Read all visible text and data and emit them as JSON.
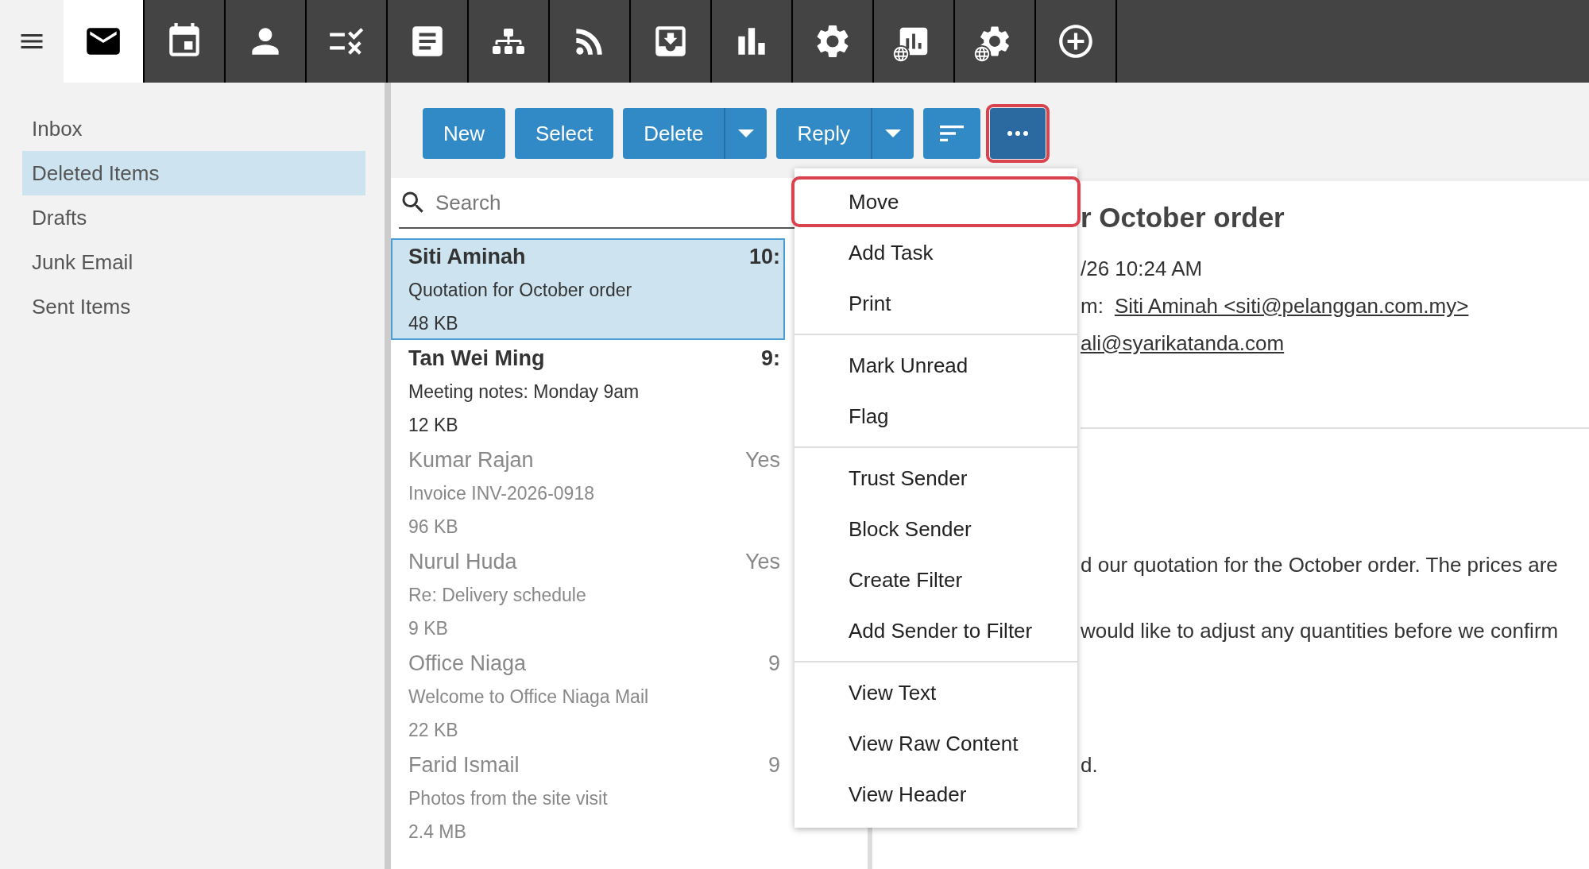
{
  "app_tabs": [
    {
      "kind": "mail",
      "selected": true
    },
    {
      "kind": "calendar",
      "selected": false
    },
    {
      "kind": "contacts",
      "selected": false
    },
    {
      "kind": "tasks",
      "selected": false
    },
    {
      "kind": "notes",
      "selected": false
    },
    {
      "kind": "tree",
      "selected": false
    },
    {
      "kind": "rss",
      "selected": false
    },
    {
      "kind": "inbox",
      "selected": false
    },
    {
      "kind": "stats",
      "selected": false
    },
    {
      "kind": "settings",
      "selected": false
    },
    {
      "kind": "webstats",
      "selected": false
    },
    {
      "kind": "websettings",
      "selected": false
    },
    {
      "kind": "add",
      "selected": false
    }
  ],
  "folders": [
    {
      "label": "Inbox",
      "selected": false
    },
    {
      "label": "Deleted Items",
      "selected": true
    },
    {
      "label": "Drafts",
      "selected": false
    },
    {
      "label": "Junk Email",
      "selected": false
    },
    {
      "label": "Sent Items",
      "selected": false
    }
  ],
  "toolbar": [
    {
      "kind": "button",
      "label": "New",
      "focused": false
    },
    {
      "kind": "button",
      "label": "Select",
      "focused": false
    },
    {
      "kind": "split",
      "label": "Delete",
      "focused": false
    },
    {
      "kind": "split",
      "label": "Reply",
      "focused": false
    },
    {
      "kind": "sort",
      "focused": false
    },
    {
      "kind": "more",
      "focused": true
    }
  ],
  "search": {
    "placeholder": "Search"
  },
  "messages": [
    {
      "sender": "Siti Aminah",
      "time": "10:",
      "subject": "Quotation for October order",
      "size": "48 KB",
      "unread": true,
      "selected": true
    },
    {
      "sender": "Tan Wei Ming",
      "time": "9:",
      "subject": "Meeting notes: Monday 9am",
      "size": "12 KB",
      "unread": true,
      "selected": false
    },
    {
      "sender": "Kumar Rajan",
      "time": "Yes",
      "subject": "Invoice INV-2026-0918",
      "size": "96 KB",
      "unread": false,
      "selected": false
    },
    {
      "sender": "Nurul Huda",
      "time": "Yes",
      "subject": "Re: Delivery schedule",
      "size": "9 KB",
      "unread": false,
      "selected": false
    },
    {
      "sender": "Office Niaga",
      "time": "9",
      "subject": "Welcome to Office Niaga Mail",
      "size": "22 KB",
      "unread": false,
      "selected": false
    },
    {
      "sender": "Farid Ismail",
      "time": "9",
      "subject": "Photos from the site visit",
      "size": "2.4 MB",
      "unread": false,
      "selected": false
    }
  ],
  "reading_pane": {
    "subject": "r October order",
    "date": "/26 10:24 AM",
    "from_label": "m:",
    "from": "Siti Aminah <siti@pelanggan.com.my>",
    "to": "ali@syarikatanda.com",
    "body": [
      "d our quotation for the October order. The prices are",
      "would like to adjust any quantities before we confirm",
      "d."
    ]
  },
  "menu": [
    [
      {
        "label": "Move",
        "focused": true
      },
      {
        "label": "Add Task",
        "focused": false
      },
      {
        "label": "Print",
        "focused": false
      }
    ],
    [
      {
        "label": "Mark Unread",
        "focused": false
      },
      {
        "label": "Flag",
        "focused": false
      }
    ],
    [
      {
        "label": "Trust Sender",
        "focused": false
      },
      {
        "label": "Block Sender",
        "focused": false
      },
      {
        "label": "Create Filter",
        "focused": false
      },
      {
        "label": "Add Sender to Filter",
        "focused": false
      }
    ],
    [
      {
        "label": "View Text",
        "focused": false
      },
      {
        "label": "View Raw Content",
        "focused": false
      },
      {
        "label": "View Header",
        "focused": false
      }
    ]
  ]
}
